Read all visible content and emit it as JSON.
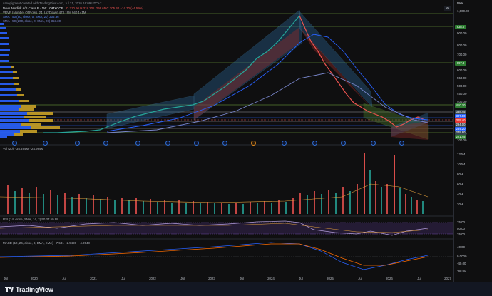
{
  "header": {
    "watermark": "sanepigment created with TradingView.com, Jul 31, 2026 16:09 UTC+2",
    "symbol_line": "Novo Nordisk A/S Class B · 1W · OMXCOP",
    "ohlc": "O 310.60 H 318.20 L 299.65 C 305.40 −14.70 (−4.59%)",
    "vrvp": "VRVP (Number Of Rows, 24, Up/Down) 473.19M 940.141M",
    "sma50": "SMA · 50 (50, close, 0, SMA, 20) 306.86",
    "sma200": "SMA · 50 (200, close, 0, SMA, 20) 353.30",
    "currency": "DKK"
  },
  "price_axis": {
    "labels": [
      "1,000.00",
      "900.00",
      "800.00",
      "700.00",
      "600.00",
      "550.00",
      "500.00",
      "450.00",
      "400.00",
      "300.00",
      "250.00",
      "200.00",
      "150.00",
      "100.00",
      "50.00",
      "0.00"
    ],
    "tags": [
      {
        "text": "935.0",
        "color": "#2e7d32"
      },
      {
        "text": "697.8",
        "color": "#2e7d32"
      },
      {
        "text": "410.70",
        "color": "#2e7d32"
      },
      {
        "text": "338.45",
        "color": "#37474f"
      },
      {
        "text": "307.00",
        "color": "#2962ff"
      },
      {
        "text": "305.40",
        "color": "#e53935"
      },
      {
        "text": "294.00",
        "color": "#37474f"
      },
      {
        "text": "264.20",
        "color": "#2962ff"
      },
      {
        "text": "245.80",
        "color": "#37474f"
      },
      {
        "text": "221.45",
        "color": "#2e7d32"
      }
    ],
    "vol_labels": [
      "120M",
      "100M",
      "80M",
      "60M",
      "40M",
      "20M"
    ],
    "rsi_labels": [
      "75.00",
      "50.00",
      "25.00"
    ],
    "macd_labels": [
      "40.00",
      "0.0000",
      "-40.00",
      "-80.00"
    ]
  },
  "volume_pane": {
    "legend": "Vol (20) · 35.464M · 24.984M"
  },
  "rsi_pane": {
    "legend": "RSI (14, close, SMA, 14, 2) 50.37 59.98"
  },
  "macd_pane": {
    "legend": "MACD (12, 26, close, 9, EMA, EMA) · 7.531 · 2.5490 · -4.9543"
  },
  "time_axis": {
    "labels": [
      "Jul",
      "2020",
      "Jul",
      "2021",
      "Jul",
      "2022",
      "Jul",
      "2023",
      "Jul",
      "2024",
      "Jul",
      "2025",
      "Jul",
      "2026",
      "Jul",
      "2027"
    ]
  },
  "footer": {
    "brand": "TradingView"
  },
  "colors": {
    "background": "#0f0f10",
    "up": "#26a69a",
    "down": "#ef5350",
    "sma50": "#2962ff",
    "sma200": "#3f51b5",
    "rsi": "#b39ddb"
  },
  "chart_data": [
    {
      "type": "line",
      "title": "Novo Nordisk A/S Class B · 1W · OMXCOP",
      "x": [
        "2020",
        "2021",
        "2022",
        "2023",
        "2024",
        "Jul 2024",
        "2025",
        "2026",
        "Jul 2026"
      ],
      "series": [
        {
          "name": "Close",
          "values": [
            250,
            330,
            520,
            690,
            880,
            1000,
            720,
            280,
            305.4
          ]
        }
      ],
      "ylim": [
        0,
        1050
      ]
    }
  ]
}
